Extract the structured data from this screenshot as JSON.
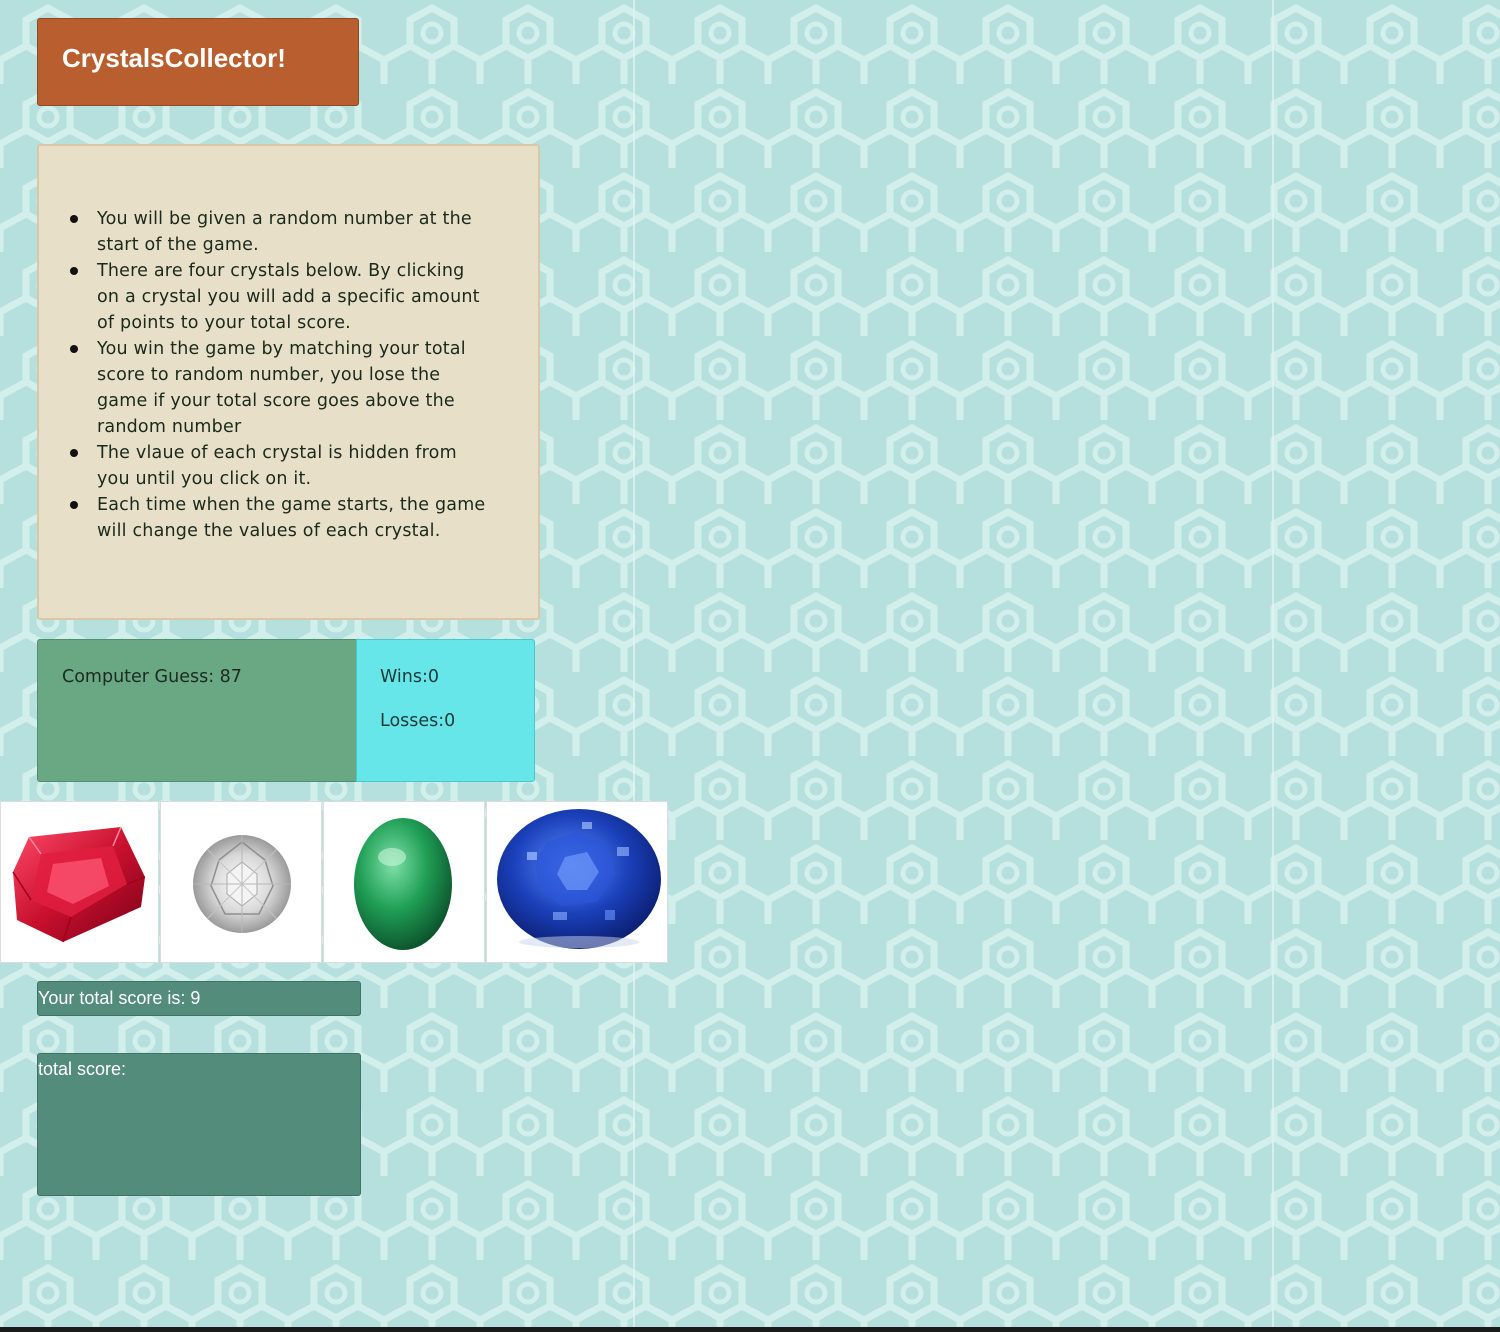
{
  "header": {
    "title": "CrystalsCollector!"
  },
  "rules": {
    "items": [
      "You will be given a random number at the start of the game.",
      "There are four crystals below. By clicking on a crystal you will add a specific amount of points to your total score.",
      "You win the game by matching your total score to random number, you lose the game if your total score goes above the random number",
      "The vlaue of each crystal is hidden from you until you click on it.",
      "Each time when the game starts, the game will change the values of each crystal."
    ]
  },
  "stats": {
    "computer_guess": "Computer Guess: 87",
    "wins": "Wins:0",
    "losses": "Losses:0"
  },
  "crystals": [
    {
      "name": "ruby",
      "color": "#c8102e"
    },
    {
      "name": "diamond",
      "color": "#e8e8e8"
    },
    {
      "name": "emerald",
      "color": "#1f9e55"
    },
    {
      "name": "sapphire",
      "color": "#1a3fb8"
    }
  ],
  "score": {
    "current": "Your total score is: 9",
    "total_label": "total score:"
  },
  "colors": {
    "background": "#b9e3e0",
    "pattern": "#cdeeec",
    "title_bg": "#b95f2f",
    "rules_bg": "#e8dfc9",
    "guess_bg": "#6aa884",
    "record_bg": "#67e6ea",
    "score_bg": "#548c7c"
  }
}
